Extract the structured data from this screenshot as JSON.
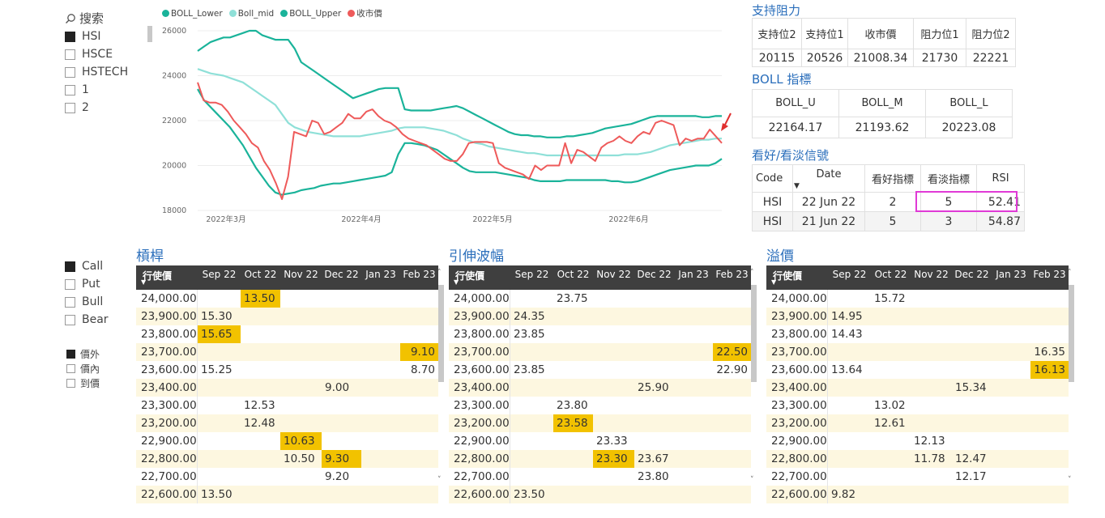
{
  "search": {
    "label": "搜索"
  },
  "index_slicer": [
    "HSI",
    "HSCE",
    "HSTECH",
    "1",
    "2"
  ],
  "index_selected": "HSI",
  "type_slicer": [
    "Call",
    "Put",
    "Bull",
    "Bear"
  ],
  "type_selected": "Call",
  "money_slicer": [
    "價外",
    "價內",
    "到價"
  ],
  "money_selected": "價外",
  "colors": {
    "lower": "#1ab39a",
    "mid": "#8fe0d8",
    "upper": "#1ab39a",
    "close": "#ee5a5a",
    "accent": "#2a6ebb",
    "highlight": "#f2c200",
    "header": "#3f3f3f",
    "magenta": "#e03ad6"
  },
  "chart_data": {
    "type": "line",
    "legend": [
      "BOLL_Lower",
      "Boll_mid",
      "BOLL_Upper",
      "收市價"
    ],
    "yticks": [
      "26000",
      "24000",
      "22000",
      "20000",
      "18000"
    ],
    "ylim": [
      18000,
      26000
    ],
    "xticks": [
      "2022年3月",
      "2022年4月",
      "2022年5月",
      "2022年6月"
    ],
    "series": [
      {
        "name": "BOLL_Lower",
        "values": [
          23400,
          22900,
          22600,
          22300,
          22000,
          21700,
          21300,
          20900,
          20400,
          19900,
          19500,
          19100,
          18800,
          18700,
          18750,
          18800,
          18900,
          18950,
          19000,
          19100,
          19150,
          19200,
          19200,
          19250,
          19300,
          19350,
          19400,
          19450,
          19500,
          19550,
          19700,
          20500,
          21000,
          21000,
          20950,
          20900,
          20800,
          20700,
          20500,
          20300,
          20100,
          19900,
          19750,
          19700,
          19700,
          19700,
          19700,
          19650,
          19600,
          19550,
          19500,
          19450,
          19350,
          19300,
          19300,
          19300,
          19300,
          19350,
          19350,
          19350,
          19350,
          19350,
          19350,
          19350,
          19300,
          19300,
          19250,
          19250,
          19300,
          19400,
          19500,
          19600,
          19700,
          19800,
          19850,
          19900,
          19950,
          20000,
          20000,
          20000,
          20100,
          20300
        ]
      },
      {
        "name": "Boll_mid",
        "values": [
          24300,
          24200,
          24100,
          24050,
          24000,
          23900,
          23800,
          23700,
          23500,
          23300,
          23100,
          22900,
          22700,
          22300,
          21900,
          21700,
          21600,
          21500,
          21450,
          21400,
          21350,
          21300,
          21300,
          21300,
          21300,
          21300,
          21350,
          21400,
          21450,
          21500,
          21550,
          21650,
          21700,
          21700,
          21700,
          21700,
          21650,
          21600,
          21550,
          21450,
          21350,
          21200,
          21100,
          21000,
          20950,
          20850,
          20800,
          20750,
          20700,
          20650,
          20600,
          20550,
          20550,
          20500,
          20450,
          20450,
          20450,
          20450,
          20450,
          20450,
          20450,
          20450,
          20450,
          20450,
          20450,
          20450,
          20500,
          20500,
          20500,
          20550,
          20600,
          20700,
          20800,
          20900,
          20950,
          21000,
          21050,
          21100,
          21150,
          21150,
          21200,
          21200
        ]
      },
      {
        "name": "BOLL_Upper",
        "values": [
          25100,
          25300,
          25500,
          25600,
          25700,
          25700,
          25800,
          25900,
          26000,
          26000,
          25800,
          25700,
          25600,
          25600,
          25600,
          25200,
          24600,
          24400,
          24200,
          24000,
          23800,
          23600,
          23400,
          23200,
          23000,
          23100,
          23200,
          23300,
          23400,
          23450,
          23450,
          23450,
          22500,
          22450,
          22450,
          22450,
          22450,
          22500,
          22550,
          22600,
          22650,
          22550,
          22400,
          22250,
          22100,
          21950,
          21800,
          21650,
          21500,
          21400,
          21350,
          21350,
          21300,
          21300,
          21250,
          21250,
          21250,
          21300,
          21300,
          21350,
          21400,
          21450,
          21550,
          21650,
          21700,
          21750,
          21800,
          21850,
          21950,
          22050,
          22150,
          22200,
          22200,
          22200,
          22200,
          22200,
          22200,
          22200,
          22150,
          22150,
          22200,
          22200
        ]
      },
      {
        "name": "收市價",
        "values": [
          23700,
          22900,
          22800,
          22800,
          22700,
          22400,
          22000,
          21700,
          21400,
          21000,
          20800,
          20200,
          19800,
          19200,
          18500,
          19500,
          21500,
          21400,
          21300,
          22000,
          21900,
          21400,
          21500,
          21700,
          21900,
          22300,
          22100,
          22100,
          22400,
          22500,
          22200,
          22000,
          21900,
          21700,
          21400,
          21200,
          21100,
          21000,
          20900,
          20700,
          20500,
          20300,
          20200,
          20200,
          20500,
          21000,
          21050,
          21050,
          21050,
          21000,
          20100,
          19900,
          19800,
          19700,
          19600,
          19400,
          20000,
          19800,
          20000,
          20000,
          20000,
          21000,
          20100,
          20700,
          20600,
          20400,
          20200,
          20800,
          21000,
          21100,
          21300,
          21100,
          21000,
          21300,
          21500,
          21400,
          21900,
          22000,
          21900,
          21800,
          20900,
          21200,
          21100,
          21200,
          21200,
          21600,
          21300,
          21000
        ]
      }
    ]
  },
  "support": {
    "title": "支持阻力",
    "headers": [
      "支持位2",
      "支持位1",
      "收市價",
      "阻力位1",
      "阻力位2"
    ],
    "values": [
      "20115",
      "20526",
      "21008.34",
      "21730",
      "22221"
    ]
  },
  "boll": {
    "title": "BOLL 指標",
    "headers": [
      "BOLL_U",
      "BOLL_M",
      "BOLL_L"
    ],
    "values": [
      "22164.17",
      "21193.62",
      "20223.08"
    ]
  },
  "signal": {
    "title": "看好/看淡信號",
    "headers": [
      "Code",
      "Date",
      "看好指標",
      "看淡指標",
      "RSI"
    ],
    "rows": [
      [
        "HSI",
        "22 Jun 22",
        "2",
        "5",
        "52.41"
      ],
      [
        "HSI",
        "21 Jun 22",
        "5",
        "3",
        "54.87"
      ]
    ]
  },
  "matrices": [
    {
      "title": "槓桿",
      "strike_header": "行使價",
      "months": [
        "Sep 22",
        "Oct 22",
        "Nov 22",
        "Dec 22",
        "Jan 23",
        "Feb 23"
      ],
      "rows": [
        {
          "strike": "24,000.00",
          "cells": [
            "",
            "13.50",
            "",
            "",
            "",
            ""
          ],
          "hl": [
            1
          ]
        },
        {
          "strike": "23,900.00",
          "cells": [
            "15.30",
            "",
            "",
            "",
            "",
            ""
          ],
          "hl": []
        },
        {
          "strike": "23,800.00",
          "cells": [
            "15.65",
            "",
            "",
            "",
            "",
            ""
          ],
          "hl": [
            0
          ]
        },
        {
          "strike": "23,700.00",
          "cells": [
            "",
            "",
            "",
            "",
            "",
            "9.10"
          ],
          "hl": [
            5
          ]
        },
        {
          "strike": "23,600.00",
          "cells": [
            "15.25",
            "",
            "",
            "",
            "",
            "8.70"
          ],
          "hl": []
        },
        {
          "strike": "23,400.00",
          "cells": [
            "",
            "",
            "",
            "9.00",
            "",
            ""
          ],
          "hl": []
        },
        {
          "strike": "23,300.00",
          "cells": [
            "",
            "12.53",
            "",
            "",
            "",
            ""
          ],
          "hl": []
        },
        {
          "strike": "23,200.00",
          "cells": [
            "",
            "12.48",
            "",
            "",
            "",
            ""
          ],
          "hl": []
        },
        {
          "strike": "22,900.00",
          "cells": [
            "",
            "",
            "10.63",
            "",
            "",
            ""
          ],
          "hl": [
            2
          ]
        },
        {
          "strike": "22,800.00",
          "cells": [
            "",
            "",
            "10.50",
            "9.30",
            "",
            ""
          ],
          "hl": [
            3
          ]
        },
        {
          "strike": "22,700.00",
          "cells": [
            "",
            "",
            "",
            "9.20",
            "",
            ""
          ],
          "hl": []
        },
        {
          "strike": "22,600.00",
          "cells": [
            "13.50",
            "",
            "",
            "",
            "",
            ""
          ],
          "hl": []
        }
      ]
    },
    {
      "title": "引伸波幅",
      "strike_header": "行使價",
      "months": [
        "Sep 22",
        "Oct 22",
        "Nov 22",
        "Dec 22",
        "Jan 23",
        "Feb 23"
      ],
      "rows": [
        {
          "strike": "24,000.00",
          "cells": [
            "",
            "23.75",
            "",
            "",
            "",
            ""
          ],
          "hl": []
        },
        {
          "strike": "23,900.00",
          "cells": [
            "24.35",
            "",
            "",
            "",
            "",
            ""
          ],
          "hl": []
        },
        {
          "strike": "23,800.00",
          "cells": [
            "23.85",
            "",
            "",
            "",
            "",
            ""
          ],
          "hl": []
        },
        {
          "strike": "23,700.00",
          "cells": [
            "",
            "",
            "",
            "",
            "",
            "22.50"
          ],
          "hl": [
            5
          ]
        },
        {
          "strike": "23,600.00",
          "cells": [
            "23.85",
            "",
            "",
            "",
            "",
            "22.90"
          ],
          "hl": []
        },
        {
          "strike": "23,400.00",
          "cells": [
            "",
            "",
            "",
            "25.90",
            "",
            ""
          ],
          "hl": []
        },
        {
          "strike": "23,300.00",
          "cells": [
            "",
            "23.80",
            "",
            "",
            "",
            ""
          ],
          "hl": []
        },
        {
          "strike": "23,200.00",
          "cells": [
            "",
            "23.58",
            "",
            "",
            "",
            ""
          ],
          "hl": [
            1
          ]
        },
        {
          "strike": "22,900.00",
          "cells": [
            "",
            "",
            "23.33",
            "",
            "",
            ""
          ],
          "hl": []
        },
        {
          "strike": "22,800.00",
          "cells": [
            "",
            "",
            "23.30",
            "23.67",
            "",
            ""
          ],
          "hl": [
            2
          ]
        },
        {
          "strike": "22,700.00",
          "cells": [
            "",
            "",
            "",
            "23.80",
            "",
            ""
          ],
          "hl": []
        },
        {
          "strike": "22,600.00",
          "cells": [
            "23.50",
            "",
            "",
            "",
            "",
            ""
          ],
          "hl": []
        }
      ]
    },
    {
      "title": "溢價",
      "strike_header": "行使價",
      "months": [
        "Sep 22",
        "Oct 22",
        "Nov 22",
        "Dec 22",
        "Jan 23",
        "Feb 23"
      ],
      "rows": [
        {
          "strike": "24,000.00",
          "cells": [
            "",
            "15.72",
            "",
            "",
            "",
            ""
          ],
          "hl": []
        },
        {
          "strike": "23,900.00",
          "cells": [
            "14.95",
            "",
            "",
            "",
            "",
            ""
          ],
          "hl": []
        },
        {
          "strike": "23,800.00",
          "cells": [
            "14.43",
            "",
            "",
            "",
            "",
            ""
          ],
          "hl": []
        },
        {
          "strike": "23,700.00",
          "cells": [
            "",
            "",
            "",
            "",
            "",
            "16.35"
          ],
          "hl": []
        },
        {
          "strike": "23,600.00",
          "cells": [
            "13.64",
            "",
            "",
            "",
            "",
            "16.13"
          ],
          "hl": [
            5
          ]
        },
        {
          "strike": "23,400.00",
          "cells": [
            "",
            "",
            "",
            "15.34",
            "",
            ""
          ],
          "hl": []
        },
        {
          "strike": "23,300.00",
          "cells": [
            "",
            "13.02",
            "",
            "",
            "",
            ""
          ],
          "hl": []
        },
        {
          "strike": "23,200.00",
          "cells": [
            "",
            "12.61",
            "",
            "",
            "",
            ""
          ],
          "hl": []
        },
        {
          "strike": "22,900.00",
          "cells": [
            "",
            "",
            "12.13",
            "",
            "",
            ""
          ],
          "hl": []
        },
        {
          "strike": "22,800.00",
          "cells": [
            "",
            "",
            "11.78",
            "12.47",
            "",
            ""
          ],
          "hl": []
        },
        {
          "strike": "22,700.00",
          "cells": [
            "",
            "",
            "",
            "12.17",
            "",
            ""
          ],
          "hl": []
        },
        {
          "strike": "22,600.00",
          "cells": [
            "9.82",
            "",
            "",
            "",
            "",
            ""
          ],
          "hl": []
        }
      ]
    }
  ]
}
